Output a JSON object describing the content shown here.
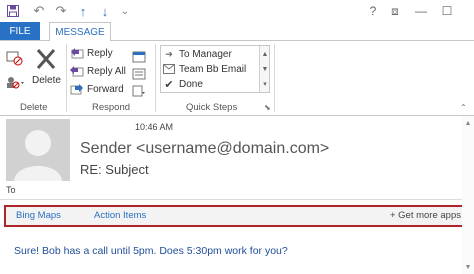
{
  "qat": {
    "save_icon": "save-icon",
    "undo_icon": "undo-icon",
    "redo_icon": "redo-icon",
    "up_icon": "up-arrow-icon",
    "down_icon": "down-arrow-icon",
    "more": "⌄"
  },
  "window_controls": {
    "help": "?",
    "restore_ribbon": "⧈",
    "minimize": "—",
    "maximize": "☐"
  },
  "tabs": {
    "file": "FILE",
    "message": "MESSAGE"
  },
  "ribbon": {
    "delete_group": {
      "label": "Delete",
      "delete_button": "Delete"
    },
    "respond_group": {
      "label": "Respond",
      "reply": "Reply",
      "reply_all": "Reply All",
      "forward": "Forward"
    },
    "quick_steps_group": {
      "label": "Quick Steps",
      "items": [
        "To Manager",
        "Team Bb Email",
        "Done"
      ]
    }
  },
  "message": {
    "time": "10:46 AM",
    "sender": "Sender <username@domain.com>",
    "subject": "RE: Subject",
    "to_label": "To",
    "body": "Sure! Bob has a call until 5pm. Does 5:30pm work for you?"
  },
  "apps_bar": {
    "apps": [
      "Bing Maps",
      "Action Items"
    ],
    "get_more": "+  Get more apps"
  },
  "colors": {
    "accent": "#2872c6",
    "highlight_border": "#b0242a",
    "body_text": "#1f4e99"
  }
}
